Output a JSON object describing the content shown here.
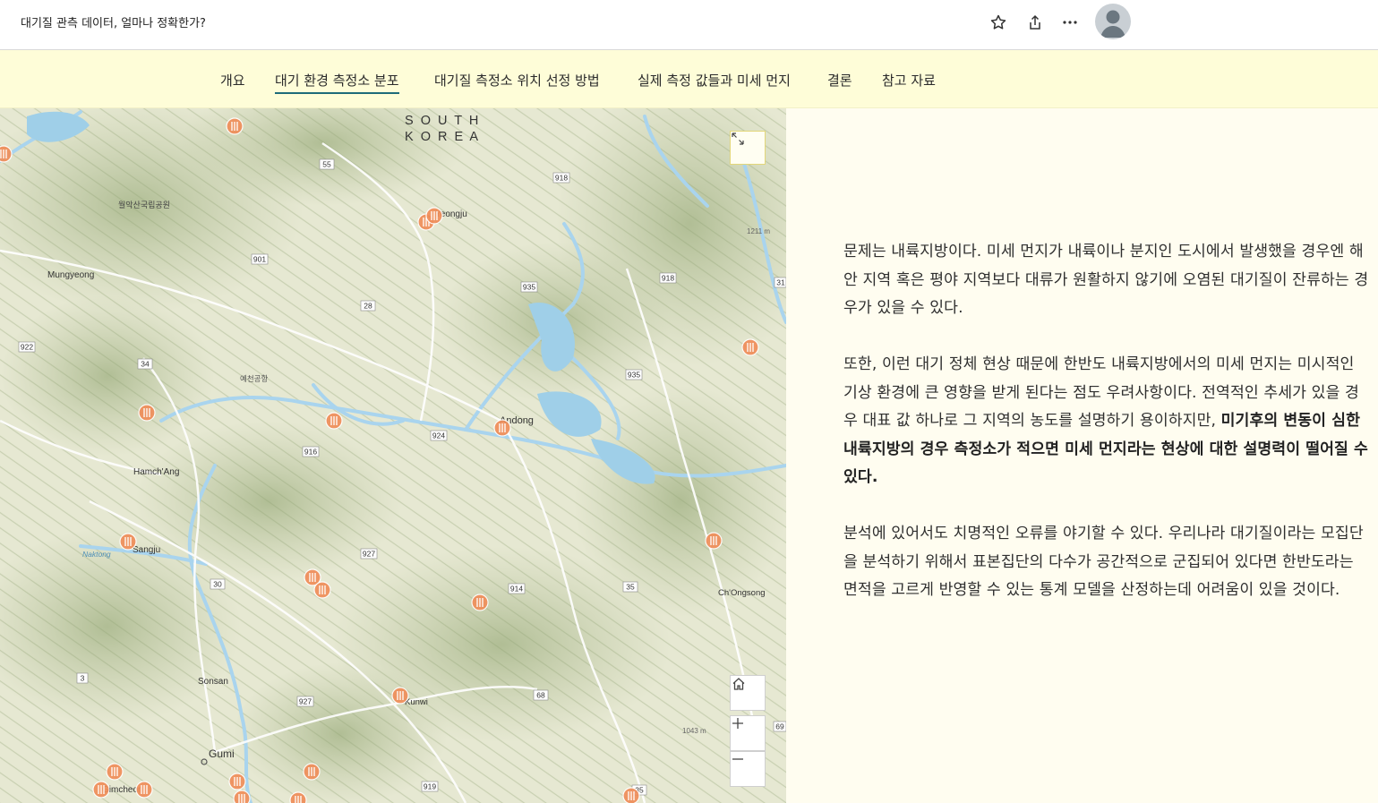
{
  "header": {
    "title": "대기질 관측 데이터, 얼마나 정확한가?",
    "icons": [
      "star-icon",
      "share-icon",
      "more-icon",
      "avatar"
    ]
  },
  "nav": {
    "items": [
      {
        "label": "개요"
      },
      {
        "label": "대기 환경 측정소 분포",
        "active": true
      },
      {
        "label": "대기질 측정소 위치 선정 방법"
      },
      {
        "label": "실제 측정 값들과 미세 먼지"
      },
      {
        "label": "결론"
      },
      {
        "label": "참고 자료"
      }
    ]
  },
  "map": {
    "labels": {
      "country_line1": "S O U T H",
      "country_line2": "K O R E A",
      "park": "월악산국립공원",
      "mungyeong": "Mungyeong",
      "yeongju": "Yeongju",
      "airport": "예천공항",
      "andong": "Andong",
      "hamchang": "Hamch'Ang",
      "sangju": "Sangju",
      "naktong": "Naktong",
      "cheongsong": "Ch'Ongsong",
      "sonsan": "Sonsan",
      "gunwi": "Kunwi",
      "gumi": "Gumi",
      "gimcheon": "Gimcheon",
      "elev1": "1211 m",
      "elev2": "1043 m",
      "river1": "Naktong"
    },
    "roads": [
      "55",
      "918",
      "901",
      "935",
      "918",
      "28",
      "922",
      "34",
      "935",
      "924",
      "916",
      "927",
      "914",
      "35",
      "30",
      "3",
      "927",
      "68",
      "919",
      "35",
      "31",
      "69"
    ],
    "stations_count": 22,
    "accent_color": "#f08e5a"
  },
  "article": {
    "p1": " 문제는 내륙지방이다. 미세 먼지가 내륙이나 분지인 도시에서 발생했을 경우엔 해안 지역 혹은 평야 지역보다 대류가 원활하지 않기에 오염된 대기질이 잔류하는 경우가 있을 수 있다.",
    "p2_a": " 또한, 이런 대기 정체 현상 때문에 한반도 내륙지방에서의 미세 먼지는 미시적인 기상 환경에 큰 영향을 받게 된다는 점도 우려사항이다. 전역적인 추세가 있을 경우 대표 값 하나로 그 지역의 농도를 설명하기 용이하지만, ",
    "p2_b": "미기후의 변동이 심한 내륙지방의 경우 측정소가 적으면 미세 먼지라는 현상에 대한 설명력이 떨어질 수 있다.",
    "p3": " 분석에 있어서도 치명적인 오류를 야기할 수 있다. 우리나라 대기질이라는 모집단을 분석하기 위해서 표본집단의 다수가 공간적으로 군집되어 있다면 한반도라는 면적을 고르게 반영할 수 있는 통계 모델을 산정하는데 어려움이 있을 것이다."
  }
}
